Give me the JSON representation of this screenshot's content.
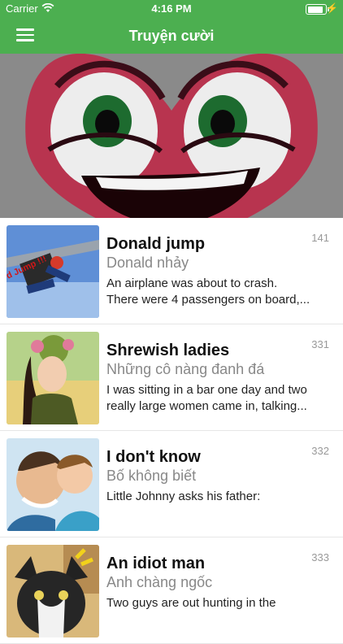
{
  "status_bar": {
    "carrier": "Carrier",
    "time": "4:16 PM",
    "battery_level": 0.9
  },
  "header": {
    "title": "Truyện cười"
  },
  "stories": [
    {
      "title": "Donald jump",
      "subtitle": "Donald nhảy",
      "line1": "An airplane was about to crash.",
      "line2": "There were 4 passengers on board,...",
      "count": "141",
      "thumb_text": "d Jump !!!"
    },
    {
      "title": "Shrewish ladies",
      "subtitle": "Những cô nàng đanh đá",
      "line1": "I was sitting in a bar one day and two",
      "line2": "really large women came in, talking...",
      "count": "331"
    },
    {
      "title": "I don't know",
      "subtitle": "Bố không biết",
      "line1": "Little Johnny asks his father:",
      "line2": "",
      "count": "332"
    },
    {
      "title": "An idiot man",
      "subtitle": "Anh chàng ngốc",
      "line1": "Two guys are out hunting in the",
      "line2": "",
      "count": "333"
    }
  ],
  "colors": {
    "header": "#4caf50",
    "title_text": "#111111",
    "subtitle_text": "#888888"
  },
  "icons": {
    "menu": "hamburger-icon",
    "wifi": "wifi-icon",
    "battery": "battery-icon",
    "charging": "charging-bolt-icon"
  }
}
